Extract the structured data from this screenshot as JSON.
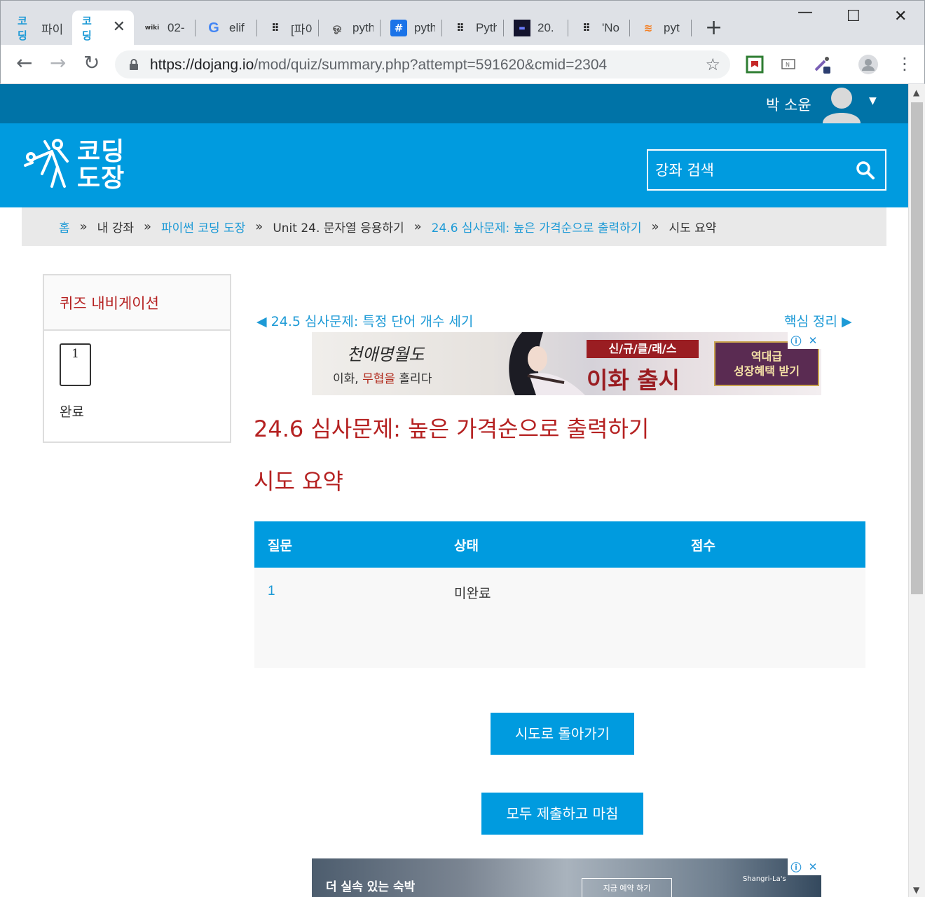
{
  "browser": {
    "tabs": [
      {
        "icon": "코딩",
        "title": "파이"
      },
      {
        "icon": "코딩",
        "title": ""
      },
      {
        "icon": "wiki",
        "title": "02-"
      },
      {
        "icon": "G",
        "title": "elif"
      },
      {
        "icon": "⠿",
        "title": "[파이"
      },
      {
        "icon": "ஓ",
        "title": "pyth"
      },
      {
        "icon": "#",
        "title": "pyth"
      },
      {
        "icon": "⠿",
        "title": "Pyth"
      },
      {
        "icon": "▬",
        "title": "20."
      },
      {
        "icon": "⠿",
        "title": "'No"
      },
      {
        "icon": "≋",
        "title": "pyt"
      }
    ],
    "url_host": "https://dojang.io",
    "url_path": "/mod/quiz/summary.php?attempt=591620&cmid=2304"
  },
  "user": {
    "name": "박 소윤"
  },
  "site": {
    "logo_line1": "코딩",
    "logo_line2": "도장",
    "search_placeholder": "강좌 검색"
  },
  "breadcrumb": [
    "홈",
    "내 강좌",
    "파이썬 코딩 도장",
    "Unit 24. 문자열 응용하기",
    "24.6 심사문제: 높은 가격순으로 출력하기",
    "시도 요약"
  ],
  "quiz_nav": {
    "title": "퀴즈 내비게이션",
    "question_number": "1",
    "status": "완료"
  },
  "nav_links": {
    "prev": "◀ 24.5 심사문제: 특정 단어 개수 세기",
    "next": "핵심 정리 ▶"
  },
  "ad_top": {
    "brand": "천애명월도",
    "tagline_pre": "이화, ",
    "tagline_em": "무협을",
    "tagline_post": " 홀리다",
    "new_class": "신/규/클/래/스",
    "release": "이화 출시",
    "bonus_line1": "역대급",
    "bonus_line2": "성장혜택 받기"
  },
  "page": {
    "title": "24.6 심사문제: 높은 가격순으로 출력하기",
    "subtitle": "시도 요약"
  },
  "summary_table": {
    "headers": [
      "질문",
      "상태",
      "점수"
    ],
    "rows": [
      {
        "question": "1",
        "status": "미완료",
        "score": ""
      }
    ]
  },
  "buttons": {
    "return": "시도로 돌아가기",
    "submit_all": "모두 제출하고 마침"
  },
  "ad_bottom": {
    "text": "더 실속 있는 숙박",
    "cta": "지금 예약 하기",
    "brand": "Shangri-La's"
  }
}
